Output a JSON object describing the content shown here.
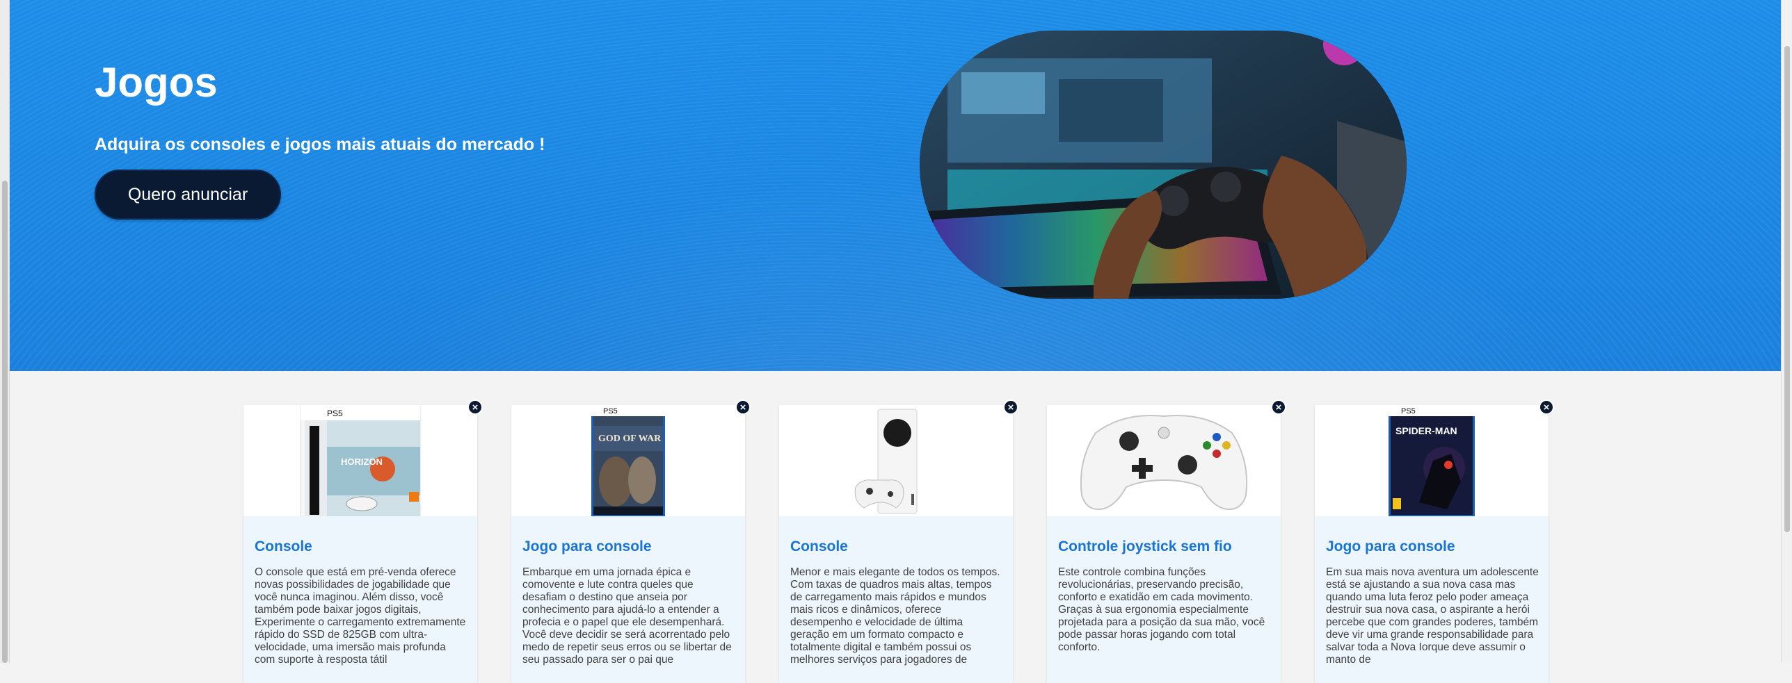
{
  "hero": {
    "title": "Jogos",
    "subtitle": "Adquira os consoles e jogos mais atuais do mercado !",
    "cta_label": "Quero anunciar",
    "image_icon": "gamer-controller-photo"
  },
  "colors": {
    "hero_blue": "#1b86e2",
    "cta_dark": "#0a1a33",
    "card_title_blue": "#1a74d2"
  },
  "cards": [
    {
      "title": "Console",
      "image": "ps5-horizon-bundle",
      "close_label": "×",
      "description": "O console que está em pré-venda oferece novas possibilidades de jogabilidade que você nunca imaginou. Além disso, você também pode baixar jogos digitais, Experimente o carregamento extremamente rápido do SSD de 825GB com ultra-velocidade, uma imersão mais profunda com suporte à resposta tátil"
    },
    {
      "title": "Jogo para console",
      "image": "god-of-war-ragnarok-box",
      "close_label": "×",
      "description": "Embarque em uma jornada épica e comovente e lute contra queles que desafiam o destino que anseia por conhecimento para ajudá-lo a entender a profecia e o papel que ele desempenhará. Você deve decidir se será acorrentado pelo medo de repetir seus erros ou se libertar de seu passado para ser o pai que"
    },
    {
      "title": "Console",
      "image": "xbox-series-s",
      "close_label": "×",
      "description": "Menor e mais elegante de todos os tempos. Com taxas de quadros mais altas, tempos de carregamento mais rápidos e mundos mais ricos e dinâmicos, oferece desempenho e velocidade de última geração em um formato compacto e totalmente digital e também possui os melhores serviços para jogadores de"
    },
    {
      "title": "Controle joystick sem fio",
      "image": "xbox-controller",
      "close_label": "×",
      "description": "Este controle combina funções revolucionárias, preservando precisão, conforto e exatidão em cada movimento. Graças à sua ergonomia especialmente projetada para a posição da sua mão, você pode passar horas jogando com total conforto."
    },
    {
      "title": "Jogo para console",
      "image": "spider-man-miles-morales-box",
      "close_label": "×",
      "description": "Em sua mais nova aventura um adolescente está se ajustando a sua nova casa mas quando uma luta feroz pelo poder ameaça destruir sua nova casa, o aspirante a herói percebe que com grandes poderes, também deve vir uma grande responsabilidade para salvar toda a Nova Iorque deve assumir o manto de"
    }
  ]
}
